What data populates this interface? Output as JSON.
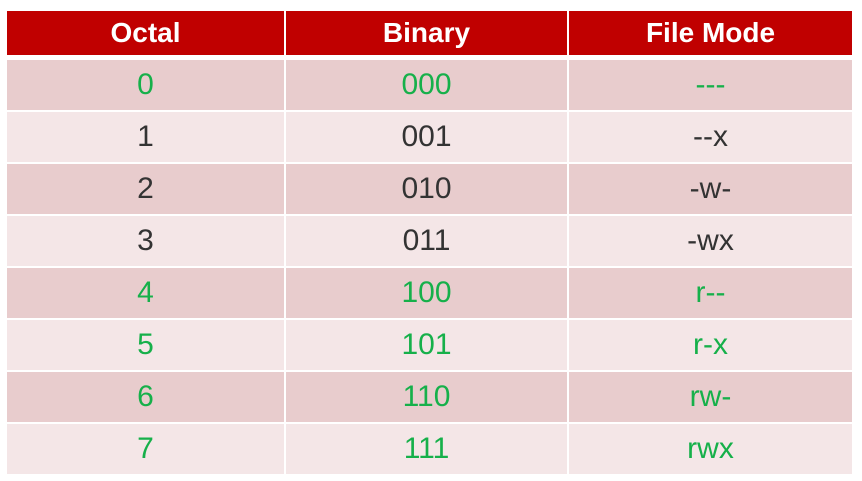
{
  "table": {
    "headers": [
      "Octal",
      "Binary",
      "File Mode"
    ],
    "rows": [
      {
        "octal": "0",
        "binary": "000",
        "mode": "---",
        "highlight": true
      },
      {
        "octal": "1",
        "binary": "001",
        "mode": "--x",
        "highlight": false
      },
      {
        "octal": "2",
        "binary": "010",
        "mode": "-w-",
        "highlight": false
      },
      {
        "octal": "3",
        "binary": "011",
        "mode": "-wx",
        "highlight": false
      },
      {
        "octal": "4",
        "binary": "100",
        "mode": "r--",
        "highlight": true
      },
      {
        "octal": "5",
        "binary": "101",
        "mode": "r-x",
        "highlight": true
      },
      {
        "octal": "6",
        "binary": "110",
        "mode": "rw-",
        "highlight": true
      },
      {
        "octal": "7",
        "binary": "111",
        "mode": "rwx",
        "highlight": true
      }
    ]
  },
  "colors": {
    "header_bg": "#c00000",
    "row_dark_bg": "#e8cccd",
    "row_light_bg": "#f4e6e7",
    "highlight_text": "#16b04a",
    "normal_text": "#333333"
  }
}
